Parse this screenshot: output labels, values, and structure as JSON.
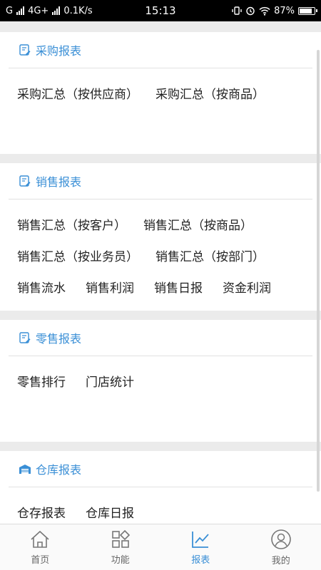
{
  "status_bar": {
    "carrier1": "G",
    "carrier2": "4G+",
    "speed": "0.1K/s",
    "time": "15:13",
    "battery_text": "87%",
    "battery_level": 0.87
  },
  "sections": {
    "purchase": {
      "title": "采购报表",
      "items": [
        "采购汇总（按供应商）",
        "采购汇总（按商品）"
      ]
    },
    "sales": {
      "title": "销售报表",
      "items": [
        "销售汇总（按客户）",
        "销售汇总（按商品）",
        "销售汇总（按业务员）",
        "销售汇总（按部门）",
        "销售流水",
        "销售利润",
        "销售日报",
        "资金利润"
      ]
    },
    "retail": {
      "title": "零售报表",
      "items": [
        "零售排行",
        "门店统计"
      ]
    },
    "warehouse": {
      "title": "仓库报表",
      "items": [
        "仓存报表",
        "仓库日报"
      ]
    }
  },
  "nav": {
    "home": "首页",
    "functions": "功能",
    "reports": "报表",
    "mine": "我的"
  },
  "colors": {
    "accent": "#3a8fd6",
    "background": "#ebebeb"
  }
}
